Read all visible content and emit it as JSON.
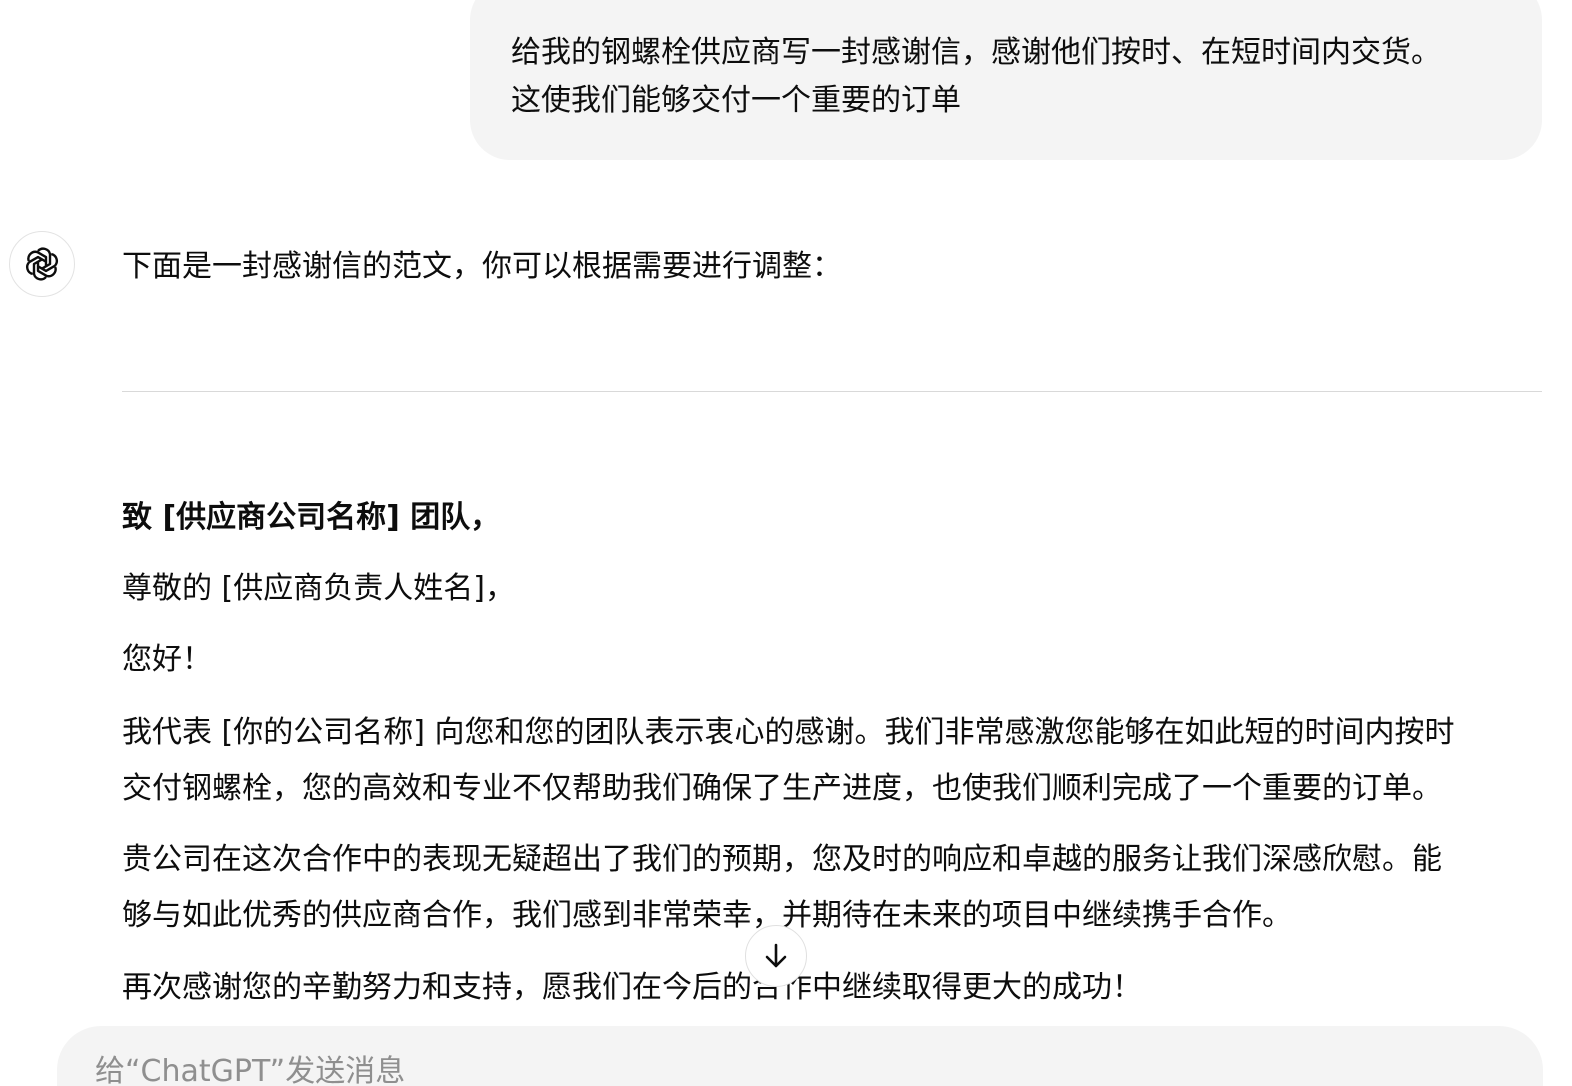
{
  "user_message": {
    "lines": [
      "给我的钢螺栓供应商写一封感谢信，感谢他们按时、在短时间内交货。",
      "这使我们能够交付一个重要的订单"
    ]
  },
  "assistant": {
    "avatar_icon": "openai-logo-icon",
    "intro": "下面是一封感谢信的范文，你可以根据需要进行调整：",
    "letter": {
      "heading": "致 [供应商公司名称] 团队，",
      "salutation": "尊敬的 [供应商负责人姓名]，",
      "greeting": "您好！",
      "paragraph_1": [
        "我代表 [你的公司名称] 向您和您的团队表示衷心的感谢。我们非常感激您能够在如此短的时间内按时",
        "交付钢螺栓，您的高效和专业不仅帮助我们确保了生产进度，也使我们顺利完成了一个重要的订单。"
      ],
      "paragraph_2": [
        "贵公司在这次合作中的表现无疑超出了我们的预期，您及时的响应和卓越的服务让我们深感欣慰。能",
        "够与如此优秀的供应商合作，我们感到非常荣幸，并期待在未来的项目中继续携手合作。"
      ],
      "closing": "再次感谢您的辛勤努力和支持，愿我们在今后的合作中继续取得更大的成功！"
    }
  },
  "scroll_button": {
    "icon": "arrow-down-icon"
  },
  "composer": {
    "placeholder": "给“ChatGPT”发送消息",
    "value": ""
  }
}
